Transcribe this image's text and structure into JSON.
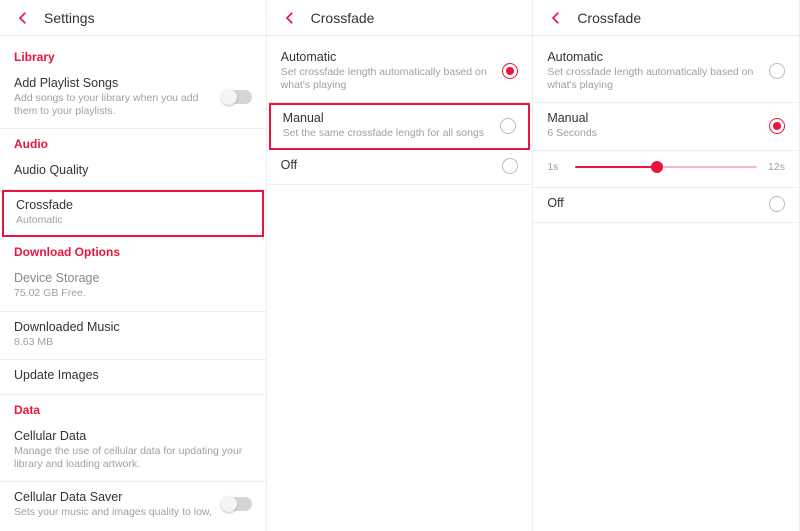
{
  "accent": "#e8163f",
  "panel1": {
    "title": "Settings",
    "sections": {
      "library": "Library",
      "audio": "Audio",
      "download": "Download Options",
      "data": "Data"
    },
    "addPlaylist": {
      "title": "Add Playlist Songs",
      "sub": "Add songs to your library when you add them to your playlists."
    },
    "audioQuality": {
      "title": "Audio Quality"
    },
    "crossfade": {
      "title": "Crossfade",
      "sub": "Automatic"
    },
    "deviceStorage": {
      "title": "Device Storage",
      "sub": "75.02 GB Free."
    },
    "downloadedMusic": {
      "title": "Downloaded Music",
      "sub": "8.63 MB"
    },
    "updateImages": {
      "title": "Update Images"
    },
    "cellularData": {
      "title": "Cellular Data",
      "sub": "Manage the use of cellular data for updating your library and loading artwork."
    },
    "cellularSaver": {
      "title": "Cellular Data Saver",
      "sub": "Sets your music and images quality to low,"
    }
  },
  "panel2": {
    "title": "Crossfade",
    "automatic": {
      "title": "Automatic",
      "sub": "Set crossfade length automatically based on what's playing"
    },
    "manual": {
      "title": "Manual",
      "sub": "Set the same crossfade length for all songs"
    },
    "off": {
      "title": "Off"
    }
  },
  "panel3": {
    "title": "Crossfade",
    "automatic": {
      "title": "Automatic",
      "sub": "Set crossfade length automatically based on what's playing"
    },
    "manual": {
      "title": "Manual",
      "sub": "6 Seconds"
    },
    "off": {
      "title": "Off"
    },
    "slider": {
      "min": "1s",
      "max": "12s",
      "valuePercent": 45
    }
  }
}
